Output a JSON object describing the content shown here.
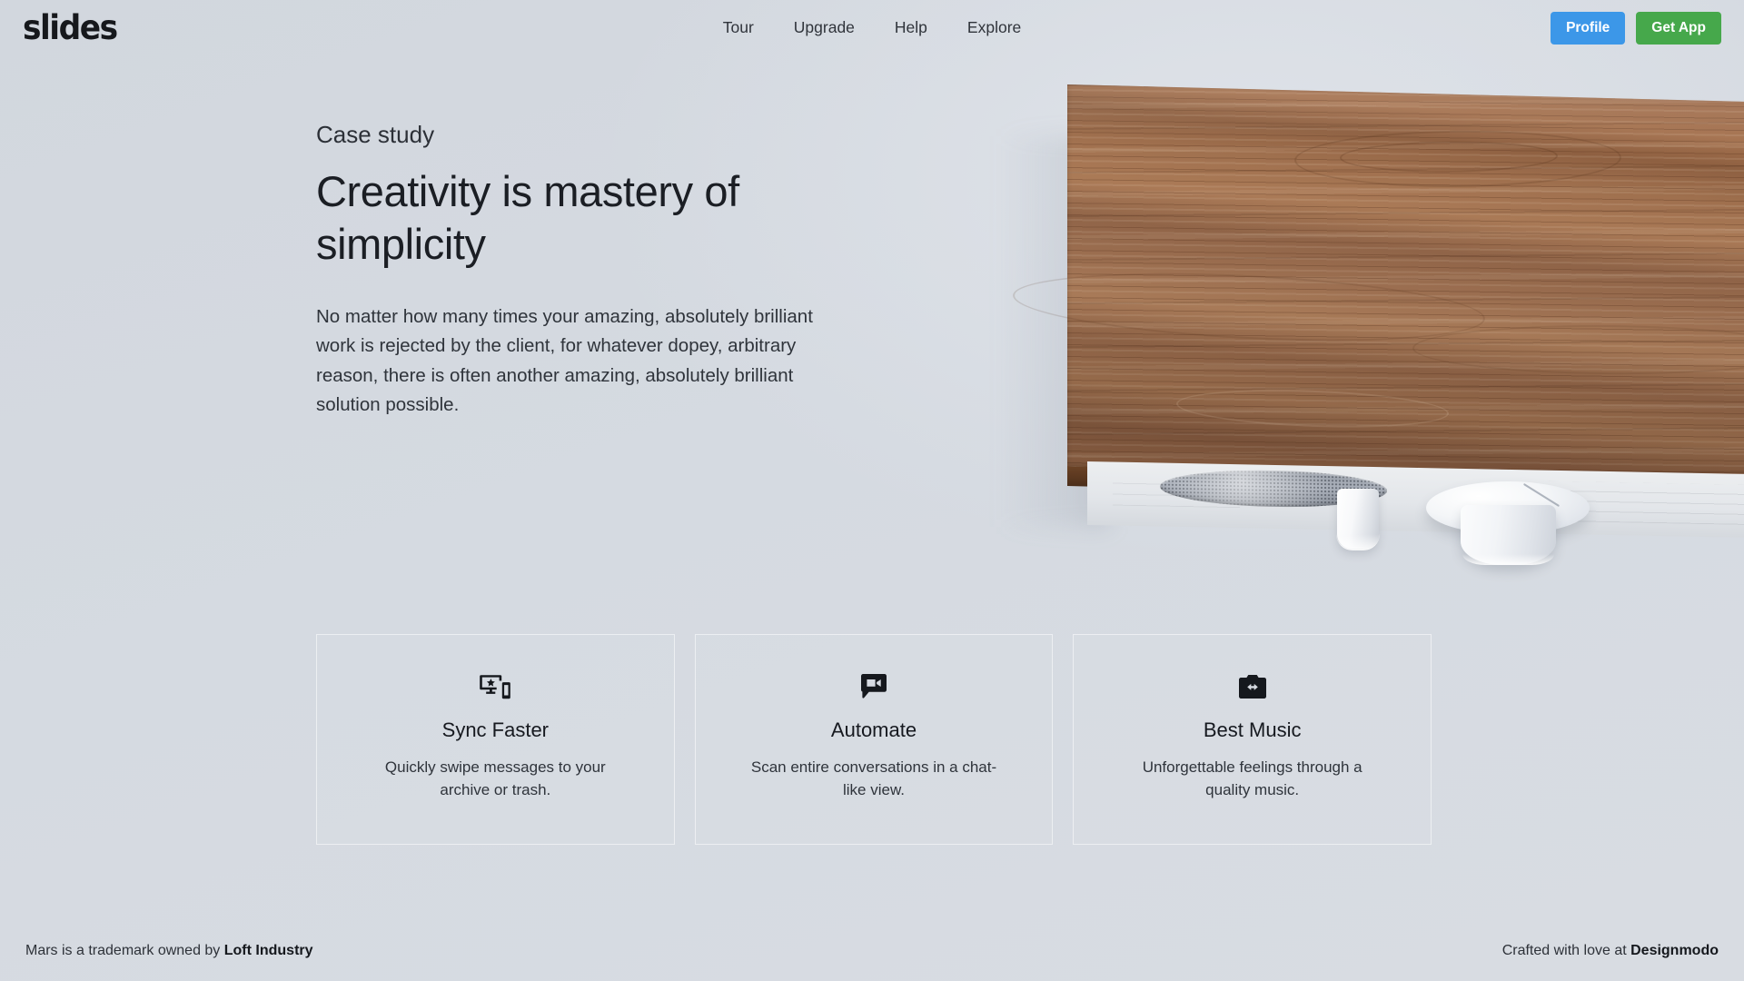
{
  "brand": {
    "logo": "slides"
  },
  "nav": {
    "items": [
      {
        "label": "Tour"
      },
      {
        "label": "Upgrade"
      },
      {
        "label": "Help"
      },
      {
        "label": "Explore"
      }
    ]
  },
  "actions": {
    "profile_label": "Profile",
    "getapp_label": "Get App",
    "profile_color": "#3c97e8",
    "getapp_color": "#46a84b"
  },
  "hero": {
    "eyebrow": "Case study",
    "headline": "Creativity is mastery of simplicity",
    "lede": "No matter how many times your amazing, absolutely brilliant work is rejected by the client, for whatever dopey, arbitrary reason, there is often another amazing, absolutely brilliant solution possible.",
    "photo_alt": "Wooden wall shelf with speaker grille, white cup and bowl"
  },
  "features": [
    {
      "icon": "devices-star-icon",
      "title": "Sync Faster",
      "desc": "Quickly swipe messages to your archive or trash."
    },
    {
      "icon": "video-chat-icon",
      "title": "Automate",
      "desc": "Scan entire conversations in a chat-like view."
    },
    {
      "icon": "camera-swap-icon",
      "title": "Best Music",
      "desc": "Unforgettable feelings through a quality music."
    }
  ],
  "footer": {
    "left_prefix": "Mars is a trademark owned by ",
    "left_strong": "Loft Industry",
    "right_prefix": "Crafted with love at ",
    "right_strong": "Designmodo"
  },
  "theme": {
    "background": "#d4d9e0",
    "text": "#1b1e24",
    "wood": "#9d6a49"
  }
}
